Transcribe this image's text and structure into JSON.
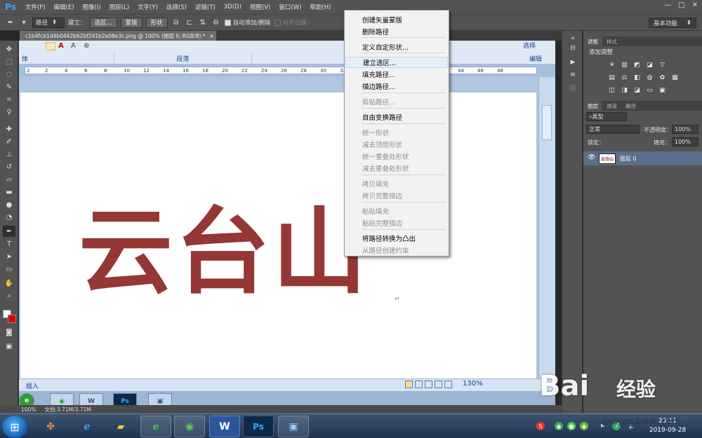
{
  "app": {
    "logo": "Ps"
  },
  "menu": [
    "文件(F)",
    "编辑(E)",
    "图像(I)",
    "图层(L)",
    "文字(Y)",
    "选择(S)",
    "滤镜(T)",
    "3D(D)",
    "视图(V)",
    "窗口(W)",
    "帮助(H)"
  ],
  "window_controls": {
    "min": "—",
    "max": "□",
    "close": "✕"
  },
  "options": {
    "tool_mode": "路径",
    "build_label": "建立：",
    "selection_btn": "选区...",
    "mask_btn": "蒙版",
    "shape_btn": "形状",
    "auto_add_label": "自动添加/删除",
    "align_edges_label": "对齐边缘",
    "workspace": "基本功能"
  },
  "document": {
    "tab_title": "c1b4fcb1d4b0442b62bf241b2a08e3c.png @ 100% (图层 0, RGB/8) *",
    "close": "×"
  },
  "word": {
    "ribbon_groups": [
      "体",
      "段落",
      "编辑"
    ],
    "ribbon_top_right": "选择",
    "ruler_numbers": [
      "2",
      "2",
      "4",
      "6",
      "8",
      "10",
      "12",
      "14",
      "16",
      "18",
      "20",
      "22",
      "24",
      "26",
      "28",
      "30",
      "32",
      "34",
      "36",
      "38",
      "40",
      "42",
      "44",
      "46",
      "48"
    ],
    "big_text": "云台山",
    "para_mark": "↵",
    "status_left": "插入",
    "zoom": "130%"
  },
  "context_menu": {
    "items": [
      {
        "label": "创建矢量蒙版",
        "disabled": false
      },
      {
        "label": "删除路径",
        "disabled": false
      },
      {
        "label": "定义自定形状...",
        "disabled": false
      },
      {
        "label": "建立选区...",
        "disabled": false,
        "hover": true
      },
      {
        "label": "填充路径...",
        "disabled": false
      },
      {
        "label": "描边路径...",
        "disabled": false
      },
      {
        "label": "剪贴路径...",
        "disabled": true
      },
      {
        "label": "自由变换路径",
        "disabled": false
      },
      {
        "label": "统一形状",
        "disabled": true
      },
      {
        "label": "减去顶层形状",
        "disabled": true
      },
      {
        "label": "统一重叠处形状",
        "disabled": true
      },
      {
        "label": "减去重叠处形状",
        "disabled": true
      },
      {
        "label": "拷贝填充",
        "disabled": true
      },
      {
        "label": "拷贝完整描边",
        "disabled": true
      },
      {
        "label": "粘贴填充",
        "disabled": true
      },
      {
        "label": "粘贴完整描边",
        "disabled": true
      },
      {
        "label": "将路径转换为凸出",
        "disabled": false
      },
      {
        "label": "从路径创建约束",
        "disabled": true
      }
    ]
  },
  "panels": {
    "adjust_tabs": [
      "调整",
      "样式"
    ],
    "adjust_title": "添加调整",
    "layer_tabs": [
      "图层",
      "通道",
      "路径"
    ],
    "kind_filter": "类型",
    "blend_mode": "正常",
    "opacity_label": "不透明度：",
    "opacity": "100%",
    "lock_label": "锁定：",
    "fill_label": "填充：",
    "fill": "100%",
    "layer_name": "图层 0"
  },
  "status": {
    "zoom": "100%",
    "doc_size": "文档:3.71M/3.71M"
  },
  "taskbar": {
    "clock_time": "23:11",
    "clock_date": "2019-09-28",
    "word_icon": "W",
    "ps_icon": "Ps"
  },
  "watermark": {
    "logo": "Bai",
    "suffix": "经验",
    "url": "jingyan.baidu.com"
  },
  "colors": {
    "text_fill": "#953734",
    "ps_blue": "#31a8ff"
  }
}
